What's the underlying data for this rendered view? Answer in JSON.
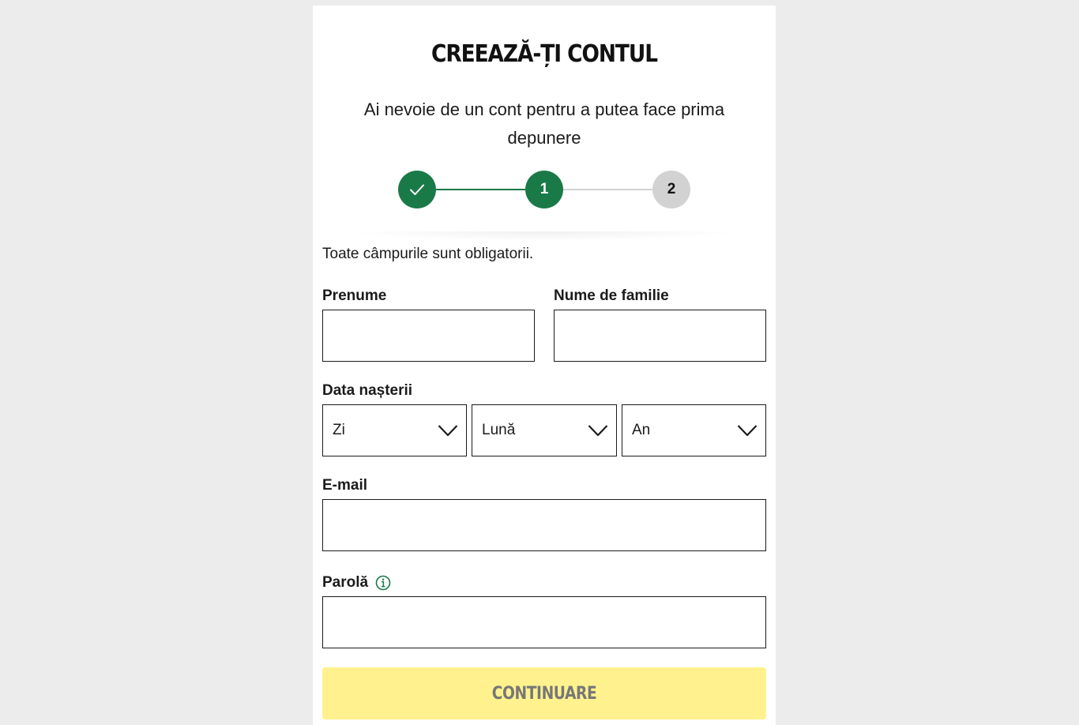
{
  "page": {
    "background_color": "#ececec",
    "accent_color": "#197a48",
    "cta_color": "#fff28e"
  },
  "header": {
    "title": "CREEAZĂ-ȚI CONTUL",
    "subtitle": "Ai nevoie de un cont pentru a putea face prima depunere"
  },
  "stepper": {
    "steps": [
      {
        "label": "",
        "state": "completed",
        "icon": "check-icon"
      },
      {
        "label": "1",
        "state": "current"
      },
      {
        "label": "2",
        "state": "upcoming"
      }
    ]
  },
  "form": {
    "required_note": "Toate câmpurile sunt obligatorii.",
    "first_name": {
      "label": "Prenume",
      "value": ""
    },
    "last_name": {
      "label": "Nume de familie",
      "value": ""
    },
    "birth_date": {
      "label": "Data nașterii",
      "day": "Zi",
      "month": "Lună",
      "year": "An"
    },
    "email": {
      "label": "E-mail",
      "value": ""
    },
    "password": {
      "label": "Parolă",
      "value": "",
      "info_icon": "info-icon"
    },
    "submit_label": "CONTINUARE",
    "submit_enabled": false
  }
}
